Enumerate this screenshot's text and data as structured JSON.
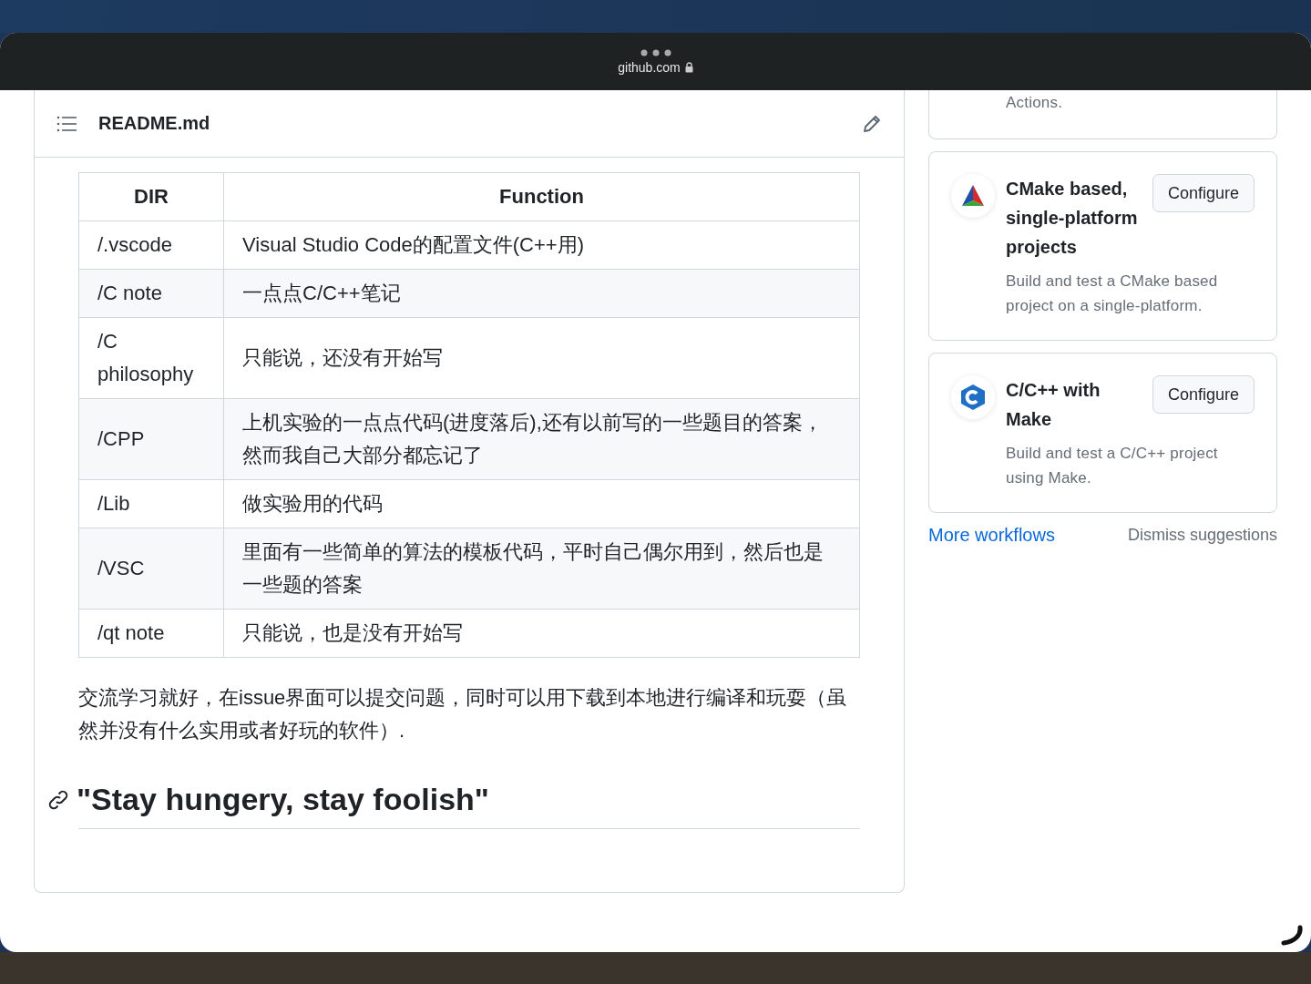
{
  "browser": {
    "url": "github.com"
  },
  "readme": {
    "title": "README.md",
    "table": {
      "columns": [
        "DIR",
        "Function"
      ],
      "rows": [
        [
          "/.vscode",
          "Visual Studio Code的配置文件(C++用)"
        ],
        [
          "/C note",
          "一点点C/C++笔记"
        ],
        [
          "/C philosophy",
          "只能说，还没有开始写"
        ],
        [
          "/CPP",
          "上机实验的一点点代码(进度落后),还有以前写的一些题目的答案，然而我自己大部分都忘记了"
        ],
        [
          "/Lib",
          "做实验用的代码"
        ],
        [
          "/VSC",
          "里面有一些简单的算法的模板代码，平时自己偶尔用到，然后也是一些题的答案"
        ],
        [
          "/qt note",
          "只能说，也是没有开始写"
        ]
      ]
    },
    "paragraph": "交流学习就好，在issue界面可以提交问题，同时可以用下载到本地进行编译和玩耍（虽然并没有什么实用或者好玩的软件）.",
    "heading": "\"Stay hungery, stay foolish\""
  },
  "workflows": {
    "partial_card_text": "Actions.",
    "cards": [
      {
        "kind": "cmake",
        "title": "CMake based, single-platform projects",
        "description": "Build and test a CMake based project on a single-platform.",
        "button": "Configure"
      },
      {
        "kind": "cpp",
        "title": "C/C++ with Make",
        "description": "Build and test a C/C++ project using Make.",
        "button": "Configure"
      }
    ],
    "more_link": "More workflows",
    "dismiss": "Dismiss suggestions"
  }
}
